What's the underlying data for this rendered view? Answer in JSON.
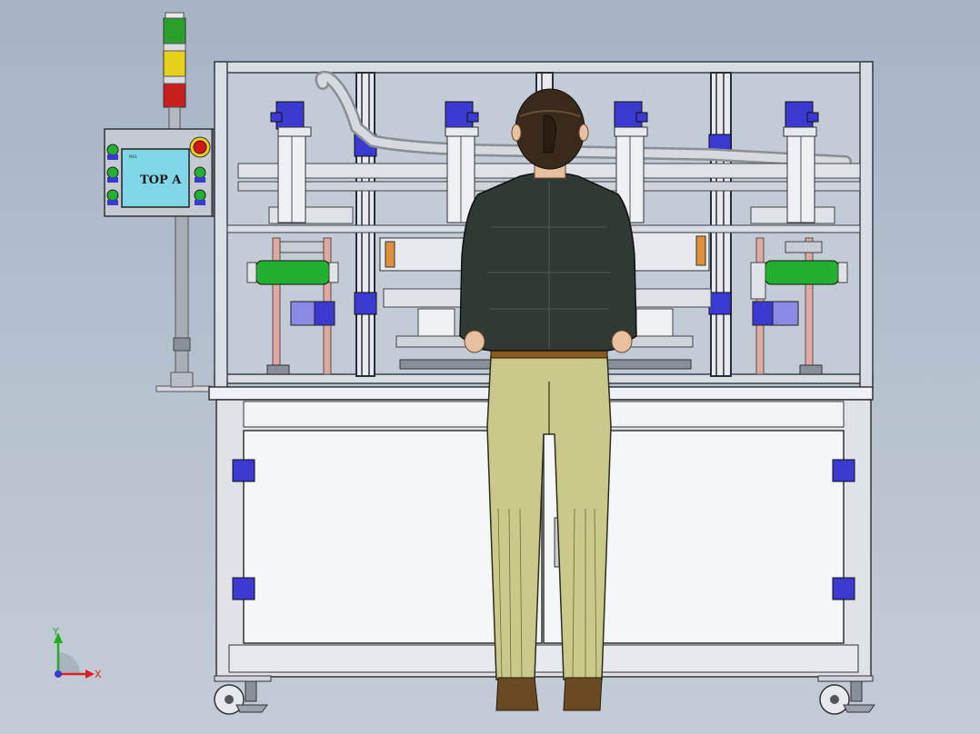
{
  "scene": {
    "hmi_screen_text": "TOP A",
    "hmi_screen_header": "MES",
    "stack_light_colors": [
      "#2aa02a",
      "#e6d21a",
      "#c81e1e"
    ]
  },
  "triad": {
    "x_label": "X",
    "y_label": "Y",
    "x_color": "#e02020",
    "y_color": "#20b020"
  },
  "colors": {
    "frame": "#d8dde4",
    "profile_dark": "#3c4048",
    "actuator_blue": "#3a3ad0",
    "roller_green": "#22b030",
    "guide_pink": "#e0a8a0",
    "cabinet": "#eef1f5",
    "jacket": "#2f3a34",
    "trousers": "#c9c98a",
    "hair": "#3a2a1c",
    "skin": "#e8c0a0",
    "shoes": "#6a4a22"
  }
}
